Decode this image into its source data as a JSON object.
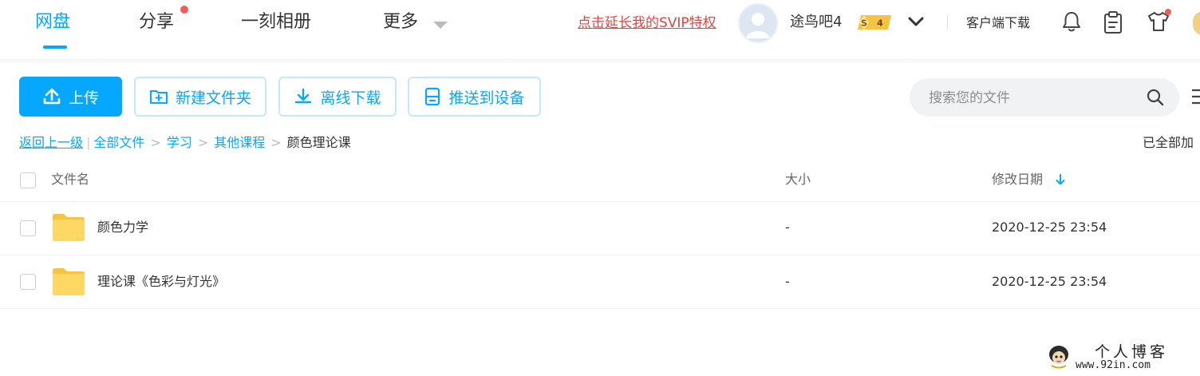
{
  "nav": {
    "tabs": [
      {
        "label": "网盘",
        "active": true
      },
      {
        "label": "分享",
        "has_dot": true
      },
      {
        "label": "一刻相册"
      },
      {
        "label": "更多",
        "has_dropdown": true
      }
    ]
  },
  "header": {
    "svip_promo": "点击延长我的SVIP特权",
    "username": "途鸟吧4",
    "vip_badge_level": "4",
    "client_download": "客户端下载",
    "icons": [
      "bell-icon",
      "clipboard-icon",
      "tshirt-icon"
    ]
  },
  "toolbar": {
    "upload": "上传",
    "new_folder": "新建文件夹",
    "offline_download": "离线下载",
    "push_to_device": "推送到设备"
  },
  "search": {
    "placeholder": "搜索您的文件"
  },
  "breadcrumb": {
    "back": "返回上一级",
    "separator_bar": "|",
    "separator": ">",
    "items": [
      "全部文件",
      "学习",
      "其他课程"
    ],
    "current": "颜色理论课"
  },
  "load_status": "已全部加",
  "table": {
    "headers": {
      "name": "文件名",
      "size": "大小",
      "modified": "修改日期"
    },
    "sort": {
      "column": "modified",
      "direction": "desc"
    },
    "rows": [
      {
        "name": "颜色力学",
        "size": "-",
        "modified": "2020-12-25 23:54",
        "type": "folder"
      },
      {
        "name": "理论课《色彩与灯光》",
        "size": "-",
        "modified": "2020-12-25 23:54",
        "type": "folder"
      }
    ]
  },
  "watermark": {
    "title": "个人博客",
    "url": "www.92in.com"
  },
  "colors": {
    "accent": "#06a7ff",
    "promo_red": "#e8423e",
    "notification_dot": "#f25d53",
    "folder_yellow": "#ffd863",
    "badge_gold": "#f5c242"
  }
}
